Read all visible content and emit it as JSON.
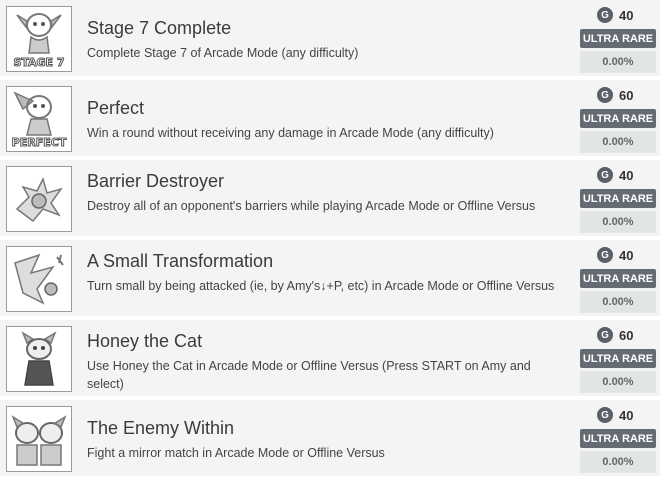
{
  "achievements": [
    {
      "image_icon": "stage-7-portrait-icon",
      "image_caption": "STAGE 7",
      "title": "Stage 7 Complete",
      "description": "Complete Stage 7 of Arcade Mode (any difficulty)",
      "gamerscore": "40",
      "rarity": "ULTRA RARE",
      "percent": "0.00%"
    },
    {
      "image_icon": "perfect-portrait-icon",
      "image_caption": "PERFECT",
      "title": "Perfect",
      "description": "Win a round without receiving any damage in Arcade Mode (any difficulty)",
      "gamerscore": "60",
      "rarity": "ULTRA RARE",
      "percent": "0.00%"
    },
    {
      "image_icon": "barrier-destroyer-icon",
      "title": "Barrier Destroyer",
      "description": "Destroy all of an opponent's barriers while playing Arcade Mode or Offline Versus",
      "gamerscore": "40",
      "rarity": "ULTRA RARE",
      "percent": "0.00%"
    },
    {
      "image_icon": "small-transformation-icon",
      "title": "A Small Transformation",
      "description": "Turn small by being attacked (ie, by Amy's↓+P, etc) in Arcade Mode or Offline Versus",
      "gamerscore": "40",
      "rarity": "ULTRA RARE",
      "percent": "0.00%"
    },
    {
      "image_icon": "honey-the-cat-icon",
      "title": "Honey the Cat",
      "description": "Use Honey the Cat in Arcade Mode or Offline Versus (Press START on Amy and select)",
      "gamerscore": "60",
      "rarity": "ULTRA RARE",
      "percent": "0.00%"
    },
    {
      "image_icon": "enemy-within-icon",
      "title": "The Enemy Within",
      "description": "Fight a mirror match in Arcade Mode or Offline Versus",
      "gamerscore": "40",
      "rarity": "ULTRA RARE",
      "percent": "0.00%"
    }
  ],
  "gamerscore_icon_letter": "G",
  "colors": {
    "row_bg": "#f4f4f4",
    "rarity_bg": "#646b73",
    "percent_bg": "#e2e6e2",
    "g_icon_bg": "#5a6068"
  }
}
